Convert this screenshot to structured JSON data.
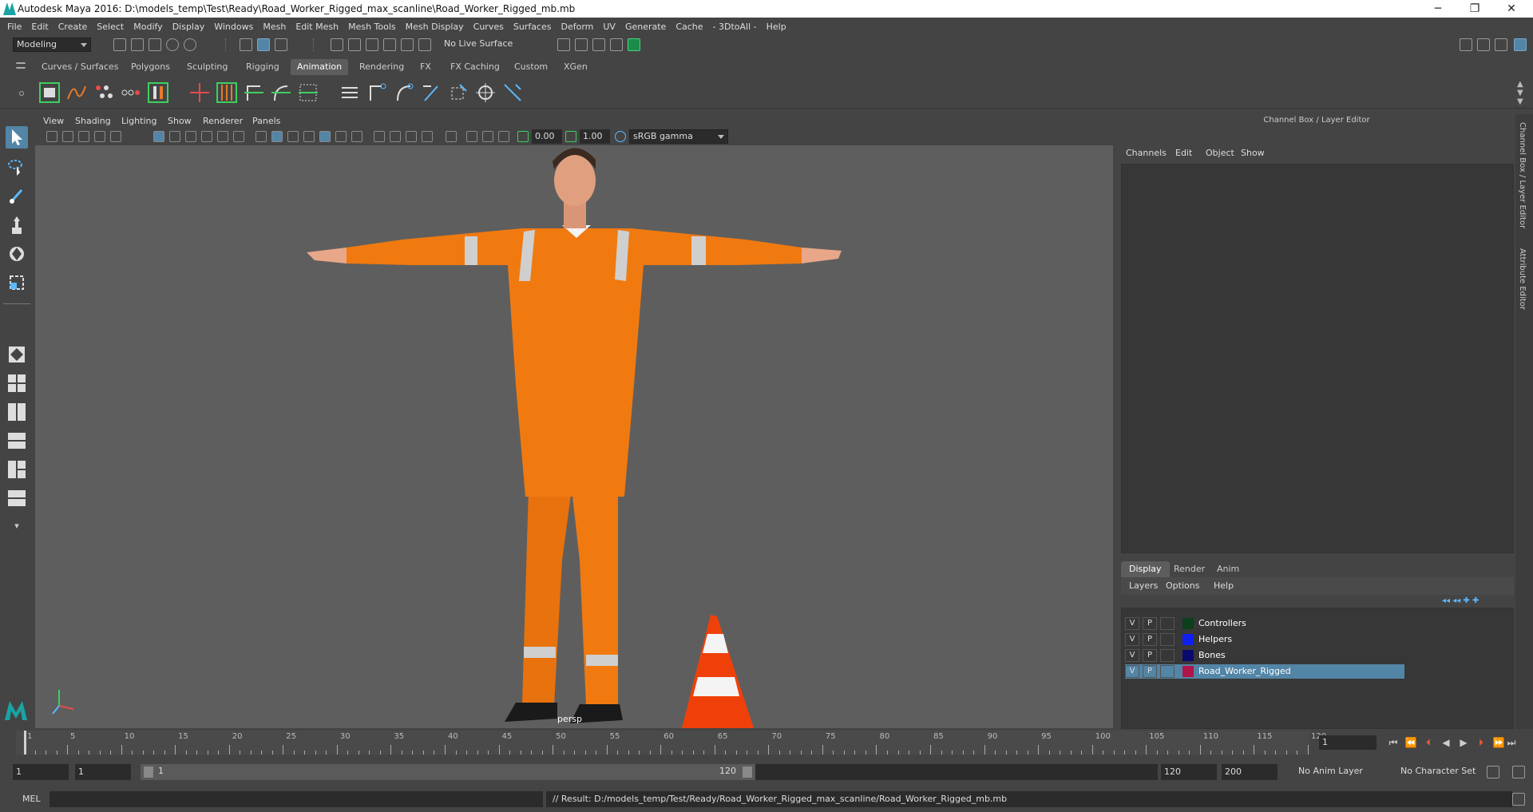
{
  "window": {
    "title": "Autodesk Maya 2016: D:\\models_temp\\Test\\Ready\\Road_Worker_Rigged_max_scanline\\Road_Worker_Rigged_mb.mb",
    "minimize": "─",
    "restore": "❐",
    "close": "✕"
  },
  "menubar": [
    "File",
    "Edit",
    "Create",
    "Select",
    "Modify",
    "Display",
    "Windows",
    "Mesh",
    "Edit Mesh",
    "Mesh Tools",
    "Mesh Display",
    "Curves",
    "Surfaces",
    "Deform",
    "UV",
    "Generate",
    "Cache",
    "- 3DtoAll -",
    "Help"
  ],
  "statusline": {
    "mode": "Modeling",
    "live_surface": "No Live Surface"
  },
  "shelf_tabs": [
    "Curves / Surfaces",
    "Polygons",
    "Sculpting",
    "Rigging",
    "Animation",
    "Rendering",
    "FX",
    "FX Caching",
    "Custom",
    "XGen"
  ],
  "active_shelf_tab": "Animation",
  "panel": {
    "menus": [
      "View",
      "Shading",
      "Lighting",
      "Show",
      "Renderer",
      "Panels"
    ],
    "exposure": "0.00",
    "gamma": "1.00",
    "color_space": "sRGB gamma",
    "camera_label": "persp"
  },
  "channel_box": {
    "title": "Channel Box / Layer Editor",
    "menus": [
      "Channels",
      "Edit",
      "Object",
      "Show"
    ]
  },
  "layer_editor": {
    "tabs": [
      "Display",
      "Render",
      "Anim"
    ],
    "active_tab": "Display",
    "menus": [
      "Layers",
      "Options",
      "Help"
    ],
    "layers": [
      {
        "v": "V",
        "p": "P",
        "name": "Controllers",
        "color": "#0c3f1c",
        "selected": false
      },
      {
        "v": "V",
        "p": "P",
        "name": "Helpers",
        "color": "#0f1ff0",
        "selected": false
      },
      {
        "v": "V",
        "p": "P",
        "name": "Bones",
        "color": "#0a0a6e",
        "selected": false
      },
      {
        "v": "V",
        "p": "P",
        "name": "Road_Worker_Rigged",
        "color": "#b0154a",
        "selected": true
      }
    ]
  },
  "side_tabs": [
    "Channel Box / Layer Editor",
    "Attribute Editor"
  ],
  "timeline": {
    "start": 1,
    "end": 120,
    "tick_labels": [
      "1",
      "5",
      "10",
      "15",
      "20",
      "25",
      "30",
      "35",
      "40",
      "45",
      "50",
      "55",
      "60",
      "65",
      "70",
      "75",
      "80",
      "85",
      "90",
      "95",
      "100",
      "105",
      "110",
      "115",
      "120"
    ],
    "current_frame": "1"
  },
  "range": {
    "start_field": "1",
    "playback_start": "1",
    "range_start_label": "1",
    "range_end_label": "120",
    "playback_end": "120",
    "end_field": "200",
    "anim_layer": "No Anim Layer",
    "character_set": "No Character Set"
  },
  "command_line": {
    "label": "MEL",
    "result": "// Result: D:/models_temp/Test/Ready/Road_Worker_Rigged_max_scanline/Road_Worker_Rigged_mb.mb"
  },
  "colors": {
    "accent": "#5285a6",
    "suit": "#f07a10",
    "viewport_bg": "#5e5e5e"
  }
}
